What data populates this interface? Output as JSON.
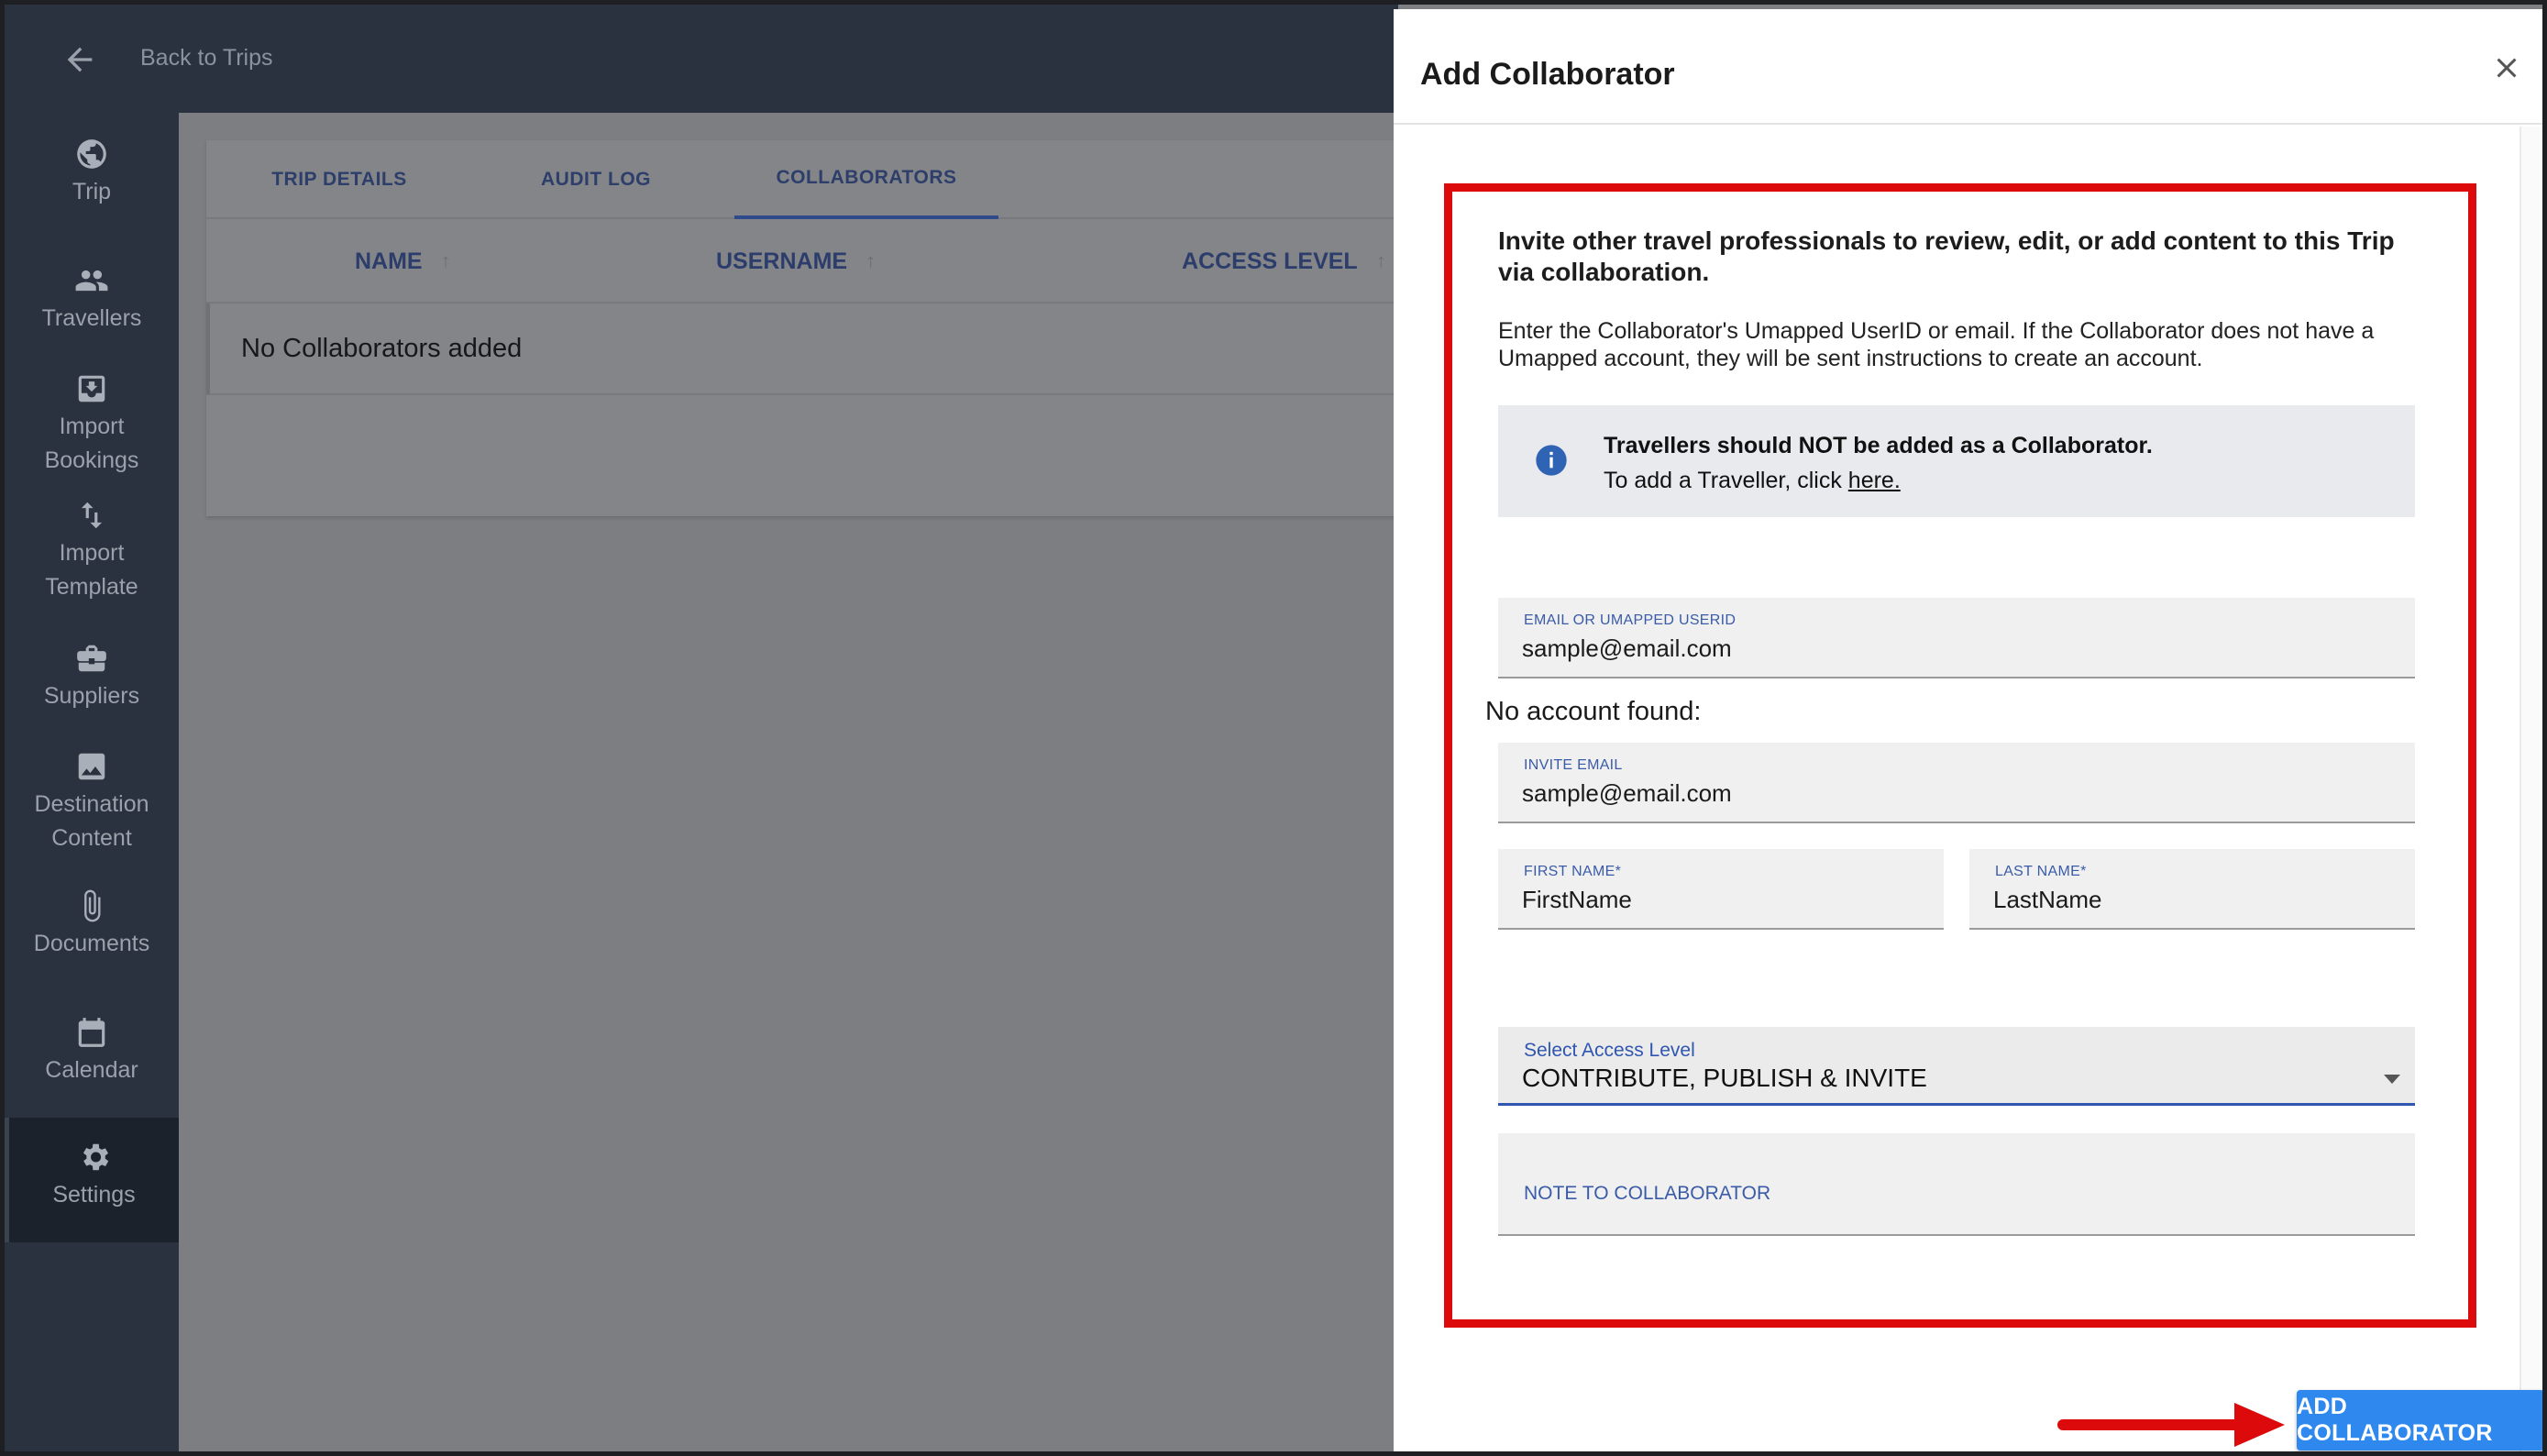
{
  "topbar": {
    "back_label": "Back to Trips"
  },
  "sidebar": {
    "items": [
      {
        "label": "Trip",
        "icon": "globe-icon"
      },
      {
        "label": "Travellers",
        "icon": "people-icon"
      },
      {
        "label": "Import Bookings",
        "icon": "import-icon"
      },
      {
        "label": "Import Template",
        "icon": "swap-vertical-icon"
      },
      {
        "label": "Suppliers",
        "icon": "briefcase-icon"
      },
      {
        "label": "Destination Content",
        "icon": "image-icon"
      },
      {
        "label": "Documents",
        "icon": "paperclip-icon"
      },
      {
        "label": "Calendar",
        "icon": "calendar-icon"
      },
      {
        "label": "Settings",
        "icon": "gear-icon"
      }
    ]
  },
  "main": {
    "tabs": [
      {
        "label": "TRIP DETAILS"
      },
      {
        "label": "AUDIT LOG"
      },
      {
        "label": "COLLABORATORS"
      }
    ],
    "columns": [
      {
        "label": "NAME"
      },
      {
        "label": "USERNAME"
      },
      {
        "label": "ACCESS LEVEL"
      }
    ],
    "empty_message": "No Collaborators added"
  },
  "dialog": {
    "title": "Add Collaborator",
    "intro": "Invite other travel professionals to review, edit, or add content to this Trip via collaboration.",
    "description": "Enter the Collaborator's Umapped UserID or email. If the Collaborator does not have a Umapped account, they will be sent instructions to create an account.",
    "info_bold": "Travellers should NOT be added as a Collaborator.",
    "info_text": "To add a Traveller, click ",
    "info_link": "here.",
    "email_field": {
      "label": "EMAIL OR UMAPPED USERID",
      "value": "sample@email.com"
    },
    "no_account_text": "No account found:",
    "invite_email": {
      "label": "INVITE EMAIL",
      "value": "sample@email.com"
    },
    "first_name": {
      "label": "FIRST NAME*",
      "value": "FirstName"
    },
    "last_name": {
      "label": "LAST NAME*",
      "value": "LastName"
    },
    "access_level": {
      "label": "Select Access Level",
      "value": "CONTRIBUTE, PUBLISH & INVITE"
    },
    "note_label": "NOTE TO COLLABORATOR",
    "submit_label": "ADD COLLABORATOR"
  },
  "colors": {
    "accent": "#2f88ee",
    "highlight": "#dc0a0a",
    "sidebar": "#2a323f"
  }
}
